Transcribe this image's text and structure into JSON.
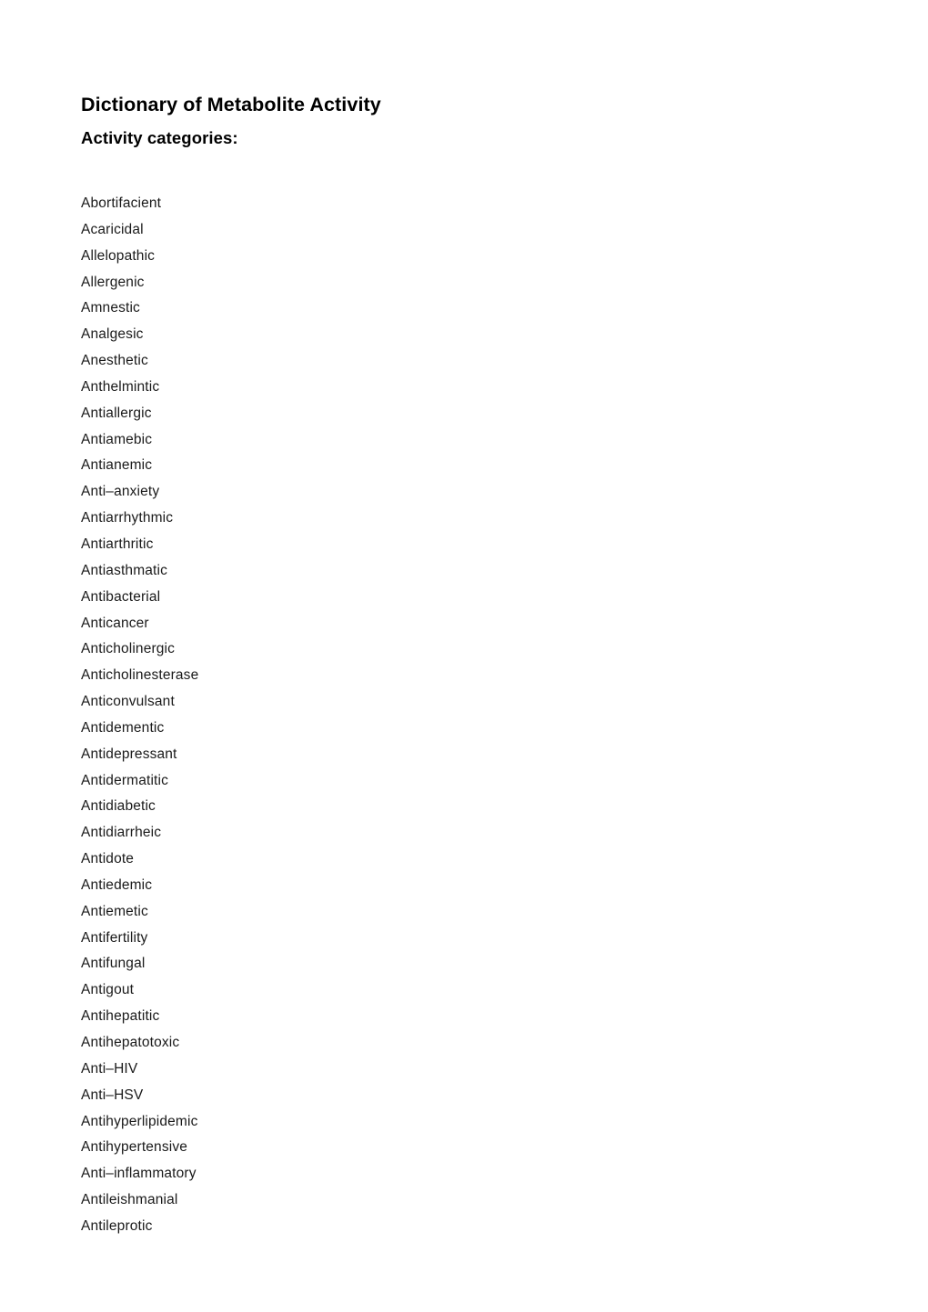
{
  "document": {
    "title": "Dictionary of Metabolite Activity",
    "subtitle": "Activity categories:",
    "categories": [
      "Abortifacient",
      "Acaricidal",
      "Allelopathic",
      "Allergenic",
      "Amnestic",
      "Analgesic",
      "Anesthetic",
      "Anthelmintic",
      "Antiallergic",
      "Antiamebic",
      "Antianemic",
      "Anti–anxiety",
      "Antiarrhythmic",
      "Antiarthritic",
      "Antiasthmatic",
      "Antibacterial",
      "Anticancer",
      "Anticholinergic",
      "Anticholinesterase",
      "Anticonvulsant",
      "Antidementic",
      "Antidepressant",
      "Antidermatitic",
      "Antidiabetic",
      "Antidiarrheic",
      "Antidote",
      "Antiedemic",
      "Antiemetic",
      "Antifertility",
      "Antifungal",
      "Antigout",
      "Antihepatitic",
      "Antihepatotoxic",
      "Anti–HIV",
      "Anti–HSV",
      "Antihyperlipidemic",
      "Antihypertensive",
      "Anti–inflammatory",
      "Antileishmanial",
      "Antileprotic"
    ]
  },
  "colors": {
    "page_background": "#ffffff",
    "text": "#000000",
    "body_text": "#1a1a1a"
  }
}
